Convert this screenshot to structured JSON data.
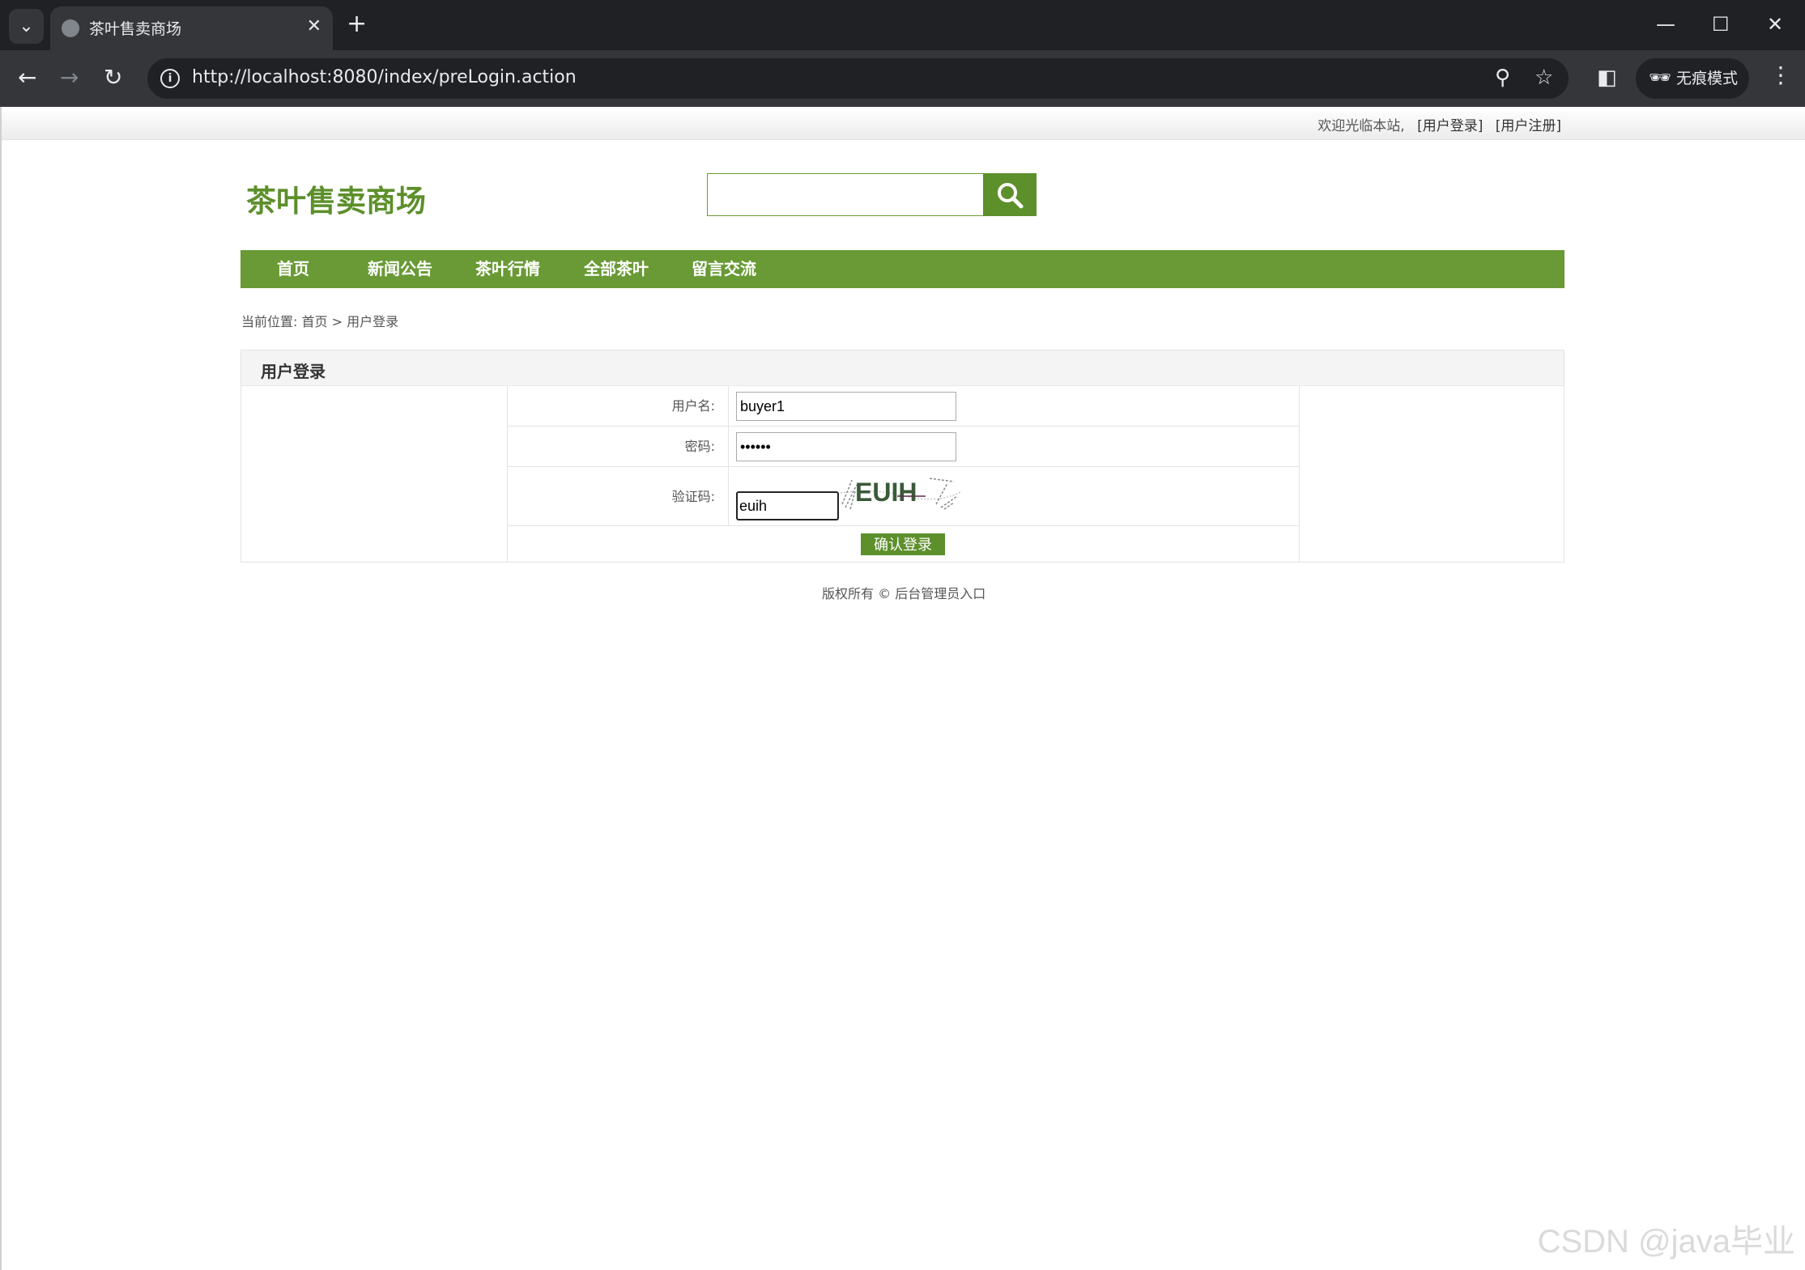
{
  "browser": {
    "tab_title": "茶叶售卖商场",
    "url": "http://localhost:8080/index/preLogin.action",
    "incognito_label": "无痕模式",
    "icons": [
      "tab-search-icon",
      "globe-icon",
      "close-icon",
      "plus-icon",
      "minimize-icon",
      "maximize-icon",
      "window-close-icon",
      "back-icon",
      "forward-icon",
      "reload-icon",
      "info-icon",
      "zoom-icon",
      "star-icon",
      "sidepanel-icon",
      "incognito-icon",
      "kebab-icon"
    ]
  },
  "topbar": {
    "welcome": "欢迎光临本站,",
    "login_link": "[用户登录]",
    "register_link": "[用户注册]"
  },
  "header": {
    "logo": "茶叶售卖商场",
    "search_placeholder": "",
    "accent_color": "#699a35"
  },
  "nav": {
    "items": [
      "首页",
      "新闻公告",
      "茶叶行情",
      "全部茶叶",
      "留言交流"
    ]
  },
  "breadcrumb": {
    "prefix": "当前位置:",
    "home": "首页",
    "separator": ">",
    "current": "用户登录"
  },
  "login": {
    "panel_title": "用户登录",
    "username_label": "用户名:",
    "username_value": "buyer1",
    "password_label": "密码:",
    "password_value": "••••••",
    "captcha_label": "验证码:",
    "captcha_value": "euih",
    "captcha_image_text": "EUIH",
    "submit_label": "确认登录"
  },
  "footer": {
    "text": "版权所有 ©",
    "admin_link": "后台管理员入口"
  },
  "watermark": "CSDN @java毕业"
}
